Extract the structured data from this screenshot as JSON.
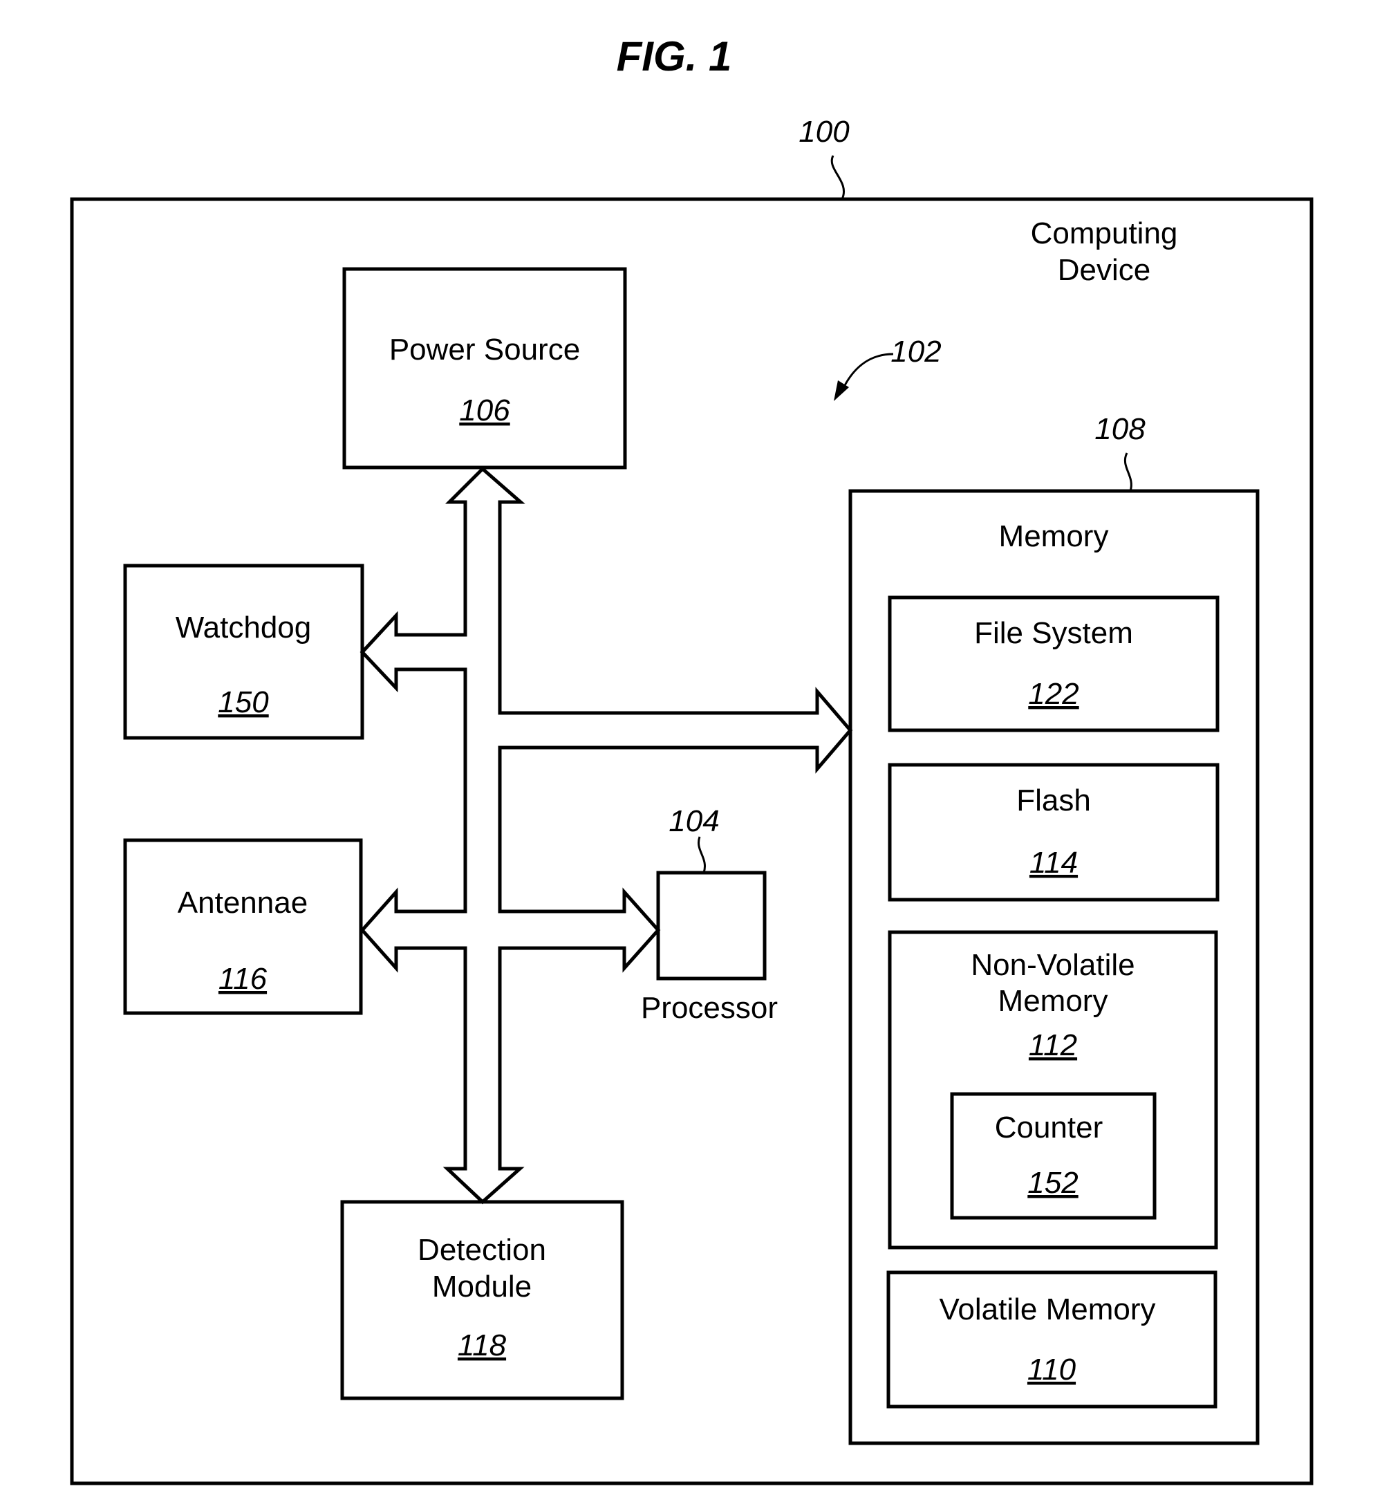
{
  "figure": {
    "title": "FIG. 1",
    "device_ref": "100",
    "device_label_line1": "Computing",
    "device_label_line2": "Device",
    "bus_ref": "102"
  },
  "blocks": {
    "power_source": {
      "label": "Power Source",
      "ref": "106"
    },
    "watchdog": {
      "label": "Watchdog",
      "ref": "150"
    },
    "antennae": {
      "label": "Antennae",
      "ref": "116"
    },
    "detection_module": {
      "label_line1": "Detection",
      "label_line2": "Module",
      "ref": "118"
    },
    "processor": {
      "label": "Processor",
      "ref": "104"
    },
    "memory": {
      "label": "Memory",
      "ref": "108",
      "file_system": {
        "label": "File System",
        "ref": "122"
      },
      "flash": {
        "label": "Flash",
        "ref": "114"
      },
      "non_volatile": {
        "label_line1": "Non-Volatile",
        "label_line2": "Memory",
        "ref": "112",
        "counter": {
          "label": "Counter",
          "ref": "152"
        }
      },
      "volatile": {
        "label": "Volatile Memory",
        "ref": "110"
      }
    }
  }
}
